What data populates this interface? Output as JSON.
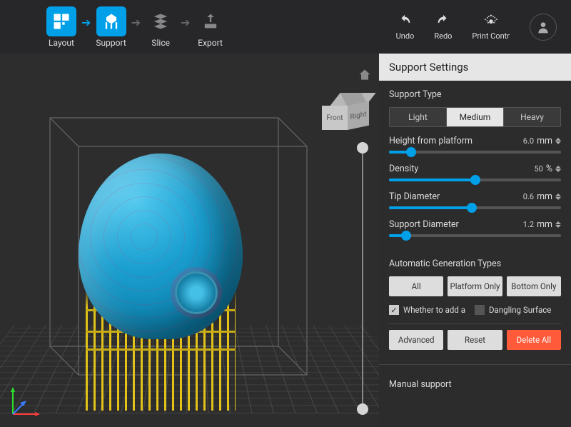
{
  "stages": {
    "layout": "Layout",
    "support": "Support",
    "slice": "Slice",
    "export": "Export"
  },
  "toolbar": {
    "undo": "Undo",
    "redo": "Redo",
    "print_control": "Print Contr"
  },
  "viewcube": {
    "front": "Front",
    "right": "Right"
  },
  "panel": {
    "title": "Support Settings",
    "support_type_label": "Support Type",
    "types": {
      "light": "Light",
      "medium": "Medium",
      "heavy": "Heavy"
    },
    "sliders": {
      "height": {
        "label": "Height from platform",
        "value": "6.0",
        "unit": "mm",
        "pct": 13
      },
      "density": {
        "label": "Density",
        "value": "50",
        "unit": "%",
        "pct": 50
      },
      "tip": {
        "label": "Tip Diameter",
        "value": "0.6",
        "unit": "mm",
        "pct": 48
      },
      "supportd": {
        "label": "Support Diameter",
        "value": "1.2",
        "unit": "mm",
        "pct": 10
      }
    },
    "autogen_label": "Automatic Generation Types",
    "autogen": {
      "all": "All",
      "platform": "Platform Only",
      "bottom": "Bottom Only"
    },
    "check1": "Whether to add a b",
    "check2": "Dangling Surface",
    "advanced": "Advanced",
    "reset": "Reset",
    "delete_all": "Delete All",
    "manual_label": "Manual support"
  }
}
